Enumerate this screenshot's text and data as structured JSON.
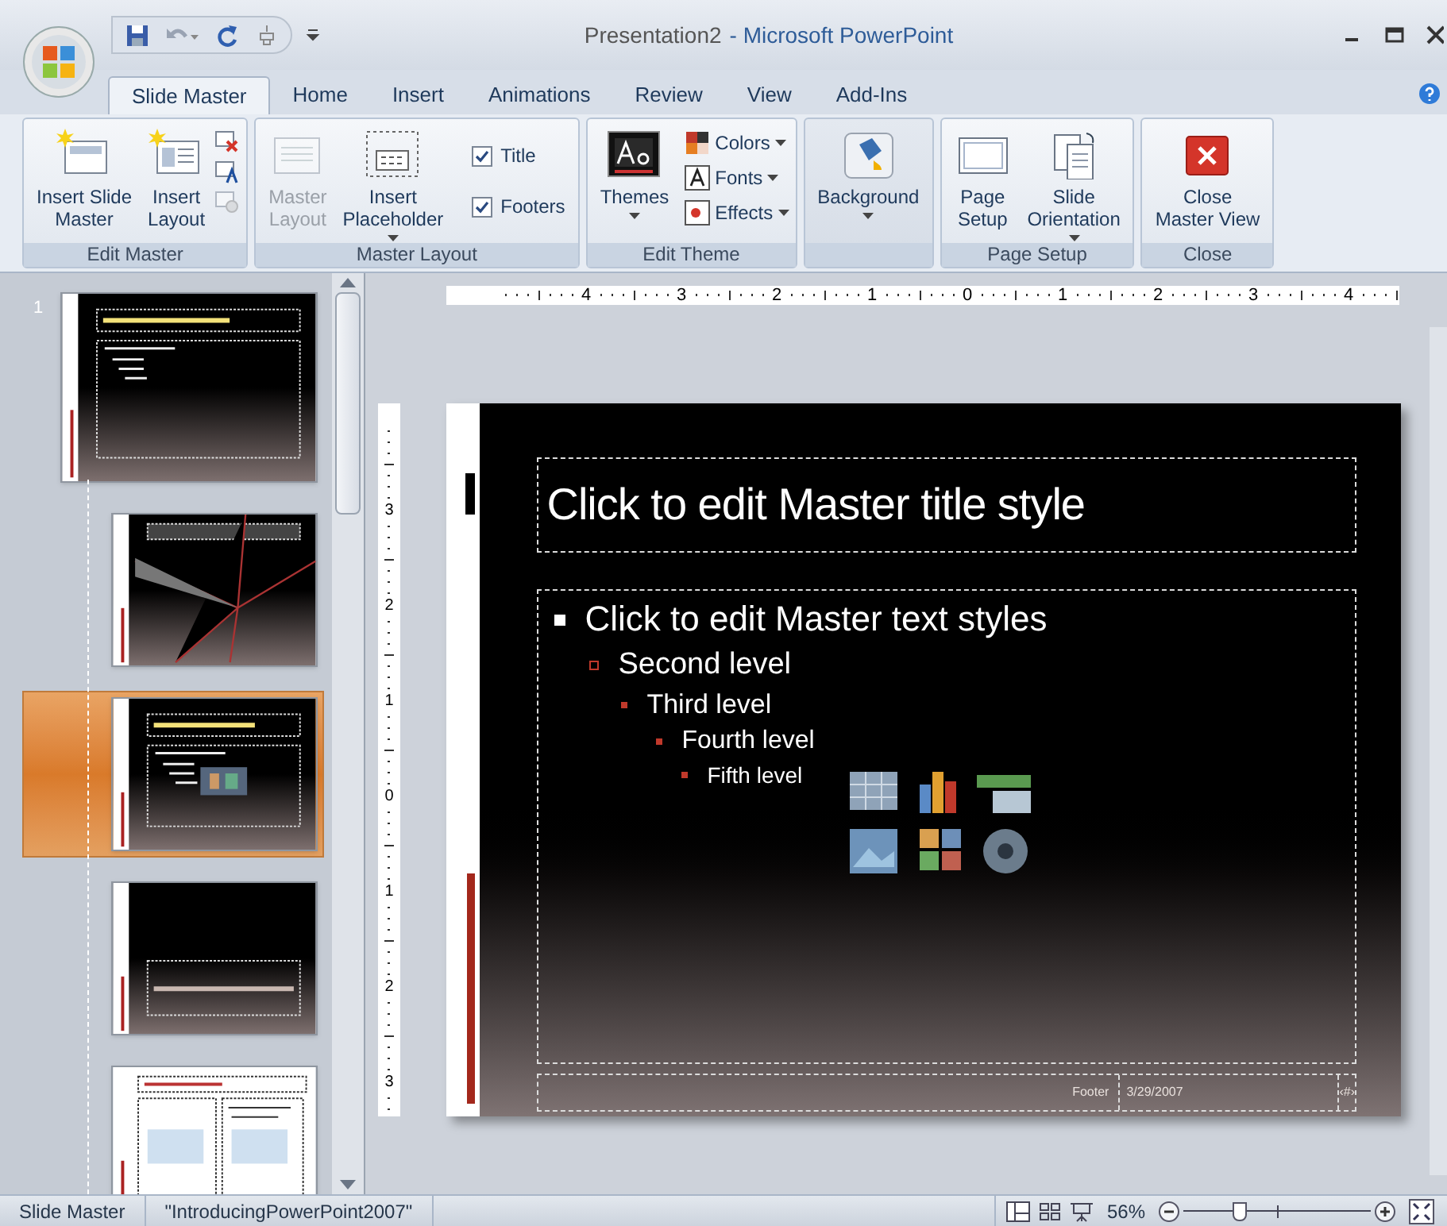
{
  "window": {
    "document": "Presentation2",
    "app": "- Microsoft PowerPoint"
  },
  "tabs": [
    {
      "label": "Slide Master",
      "selected": true
    },
    {
      "label": "Home",
      "selected": false
    },
    {
      "label": "Insert",
      "selected": false
    },
    {
      "label": "Animations",
      "selected": false
    },
    {
      "label": "Review",
      "selected": false
    },
    {
      "label": "View",
      "selected": false
    },
    {
      "label": "Add-Ins",
      "selected": false
    }
  ],
  "ribbon": [
    {
      "label": "Edit Master",
      "items": [
        {
          "kind": "large",
          "label": "Insert Slide\nMaster",
          "disabled": false,
          "dropdown": false
        },
        {
          "kind": "large",
          "label": "Insert\nLayout",
          "disabled": false,
          "dropdown": false
        },
        {
          "kind": "icon-column"
        }
      ]
    },
    {
      "label": "Master Layout",
      "items": [
        {
          "kind": "large",
          "label": "Master\nLayout",
          "disabled": true,
          "dropdown": false
        },
        {
          "kind": "large",
          "label": "Insert\nPlaceholder",
          "disabled": false,
          "dropdown": true
        },
        {
          "kind": "checks",
          "checks": [
            {
              "label": "Title",
              "checked": true
            },
            {
              "label": "Footers",
              "checked": true
            }
          ]
        }
      ]
    },
    {
      "label": "Edit Theme",
      "items": [
        {
          "kind": "large",
          "label": "Themes",
          "disabled": false,
          "dropdown": true
        },
        {
          "kind": "small-list",
          "entries": [
            {
              "label": "Colors",
              "dropdown": true
            },
            {
              "label": "Fonts",
              "dropdown": true
            },
            {
              "label": "Effects",
              "dropdown": true
            }
          ]
        }
      ]
    },
    {
      "items": [
        {
          "kind": "large",
          "label": "Background",
          "disabled": false,
          "dropdown": true
        }
      ]
    },
    {
      "label": "Page Setup",
      "items": [
        {
          "kind": "large",
          "label": "Page\nSetup",
          "disabled": false,
          "dropdown": false
        },
        {
          "kind": "large",
          "label": "Slide\nOrientation",
          "disabled": false,
          "dropdown": true
        }
      ]
    },
    {
      "label": "Close",
      "items": [
        {
          "kind": "large",
          "label": "Close\nMaster View",
          "disabled": false,
          "dropdown": false
        }
      ]
    }
  ],
  "thumbnails": [
    {
      "number": "1",
      "kind": "dark",
      "selected": false
    },
    {
      "kind": "rays",
      "selected": false
    },
    {
      "kind": "content",
      "selected": true
    },
    {
      "kind": "section",
      "selected": false
    },
    {
      "kind": "two-content",
      "selected": false
    }
  ],
  "ruler": {
    "horizontal": [
      "4",
      "3",
      "2",
      "1",
      "0",
      "1",
      "2",
      "3",
      "4"
    ],
    "vertical": [
      "3",
      "2",
      "1",
      "0",
      "1",
      "2",
      "3"
    ]
  },
  "slide": {
    "title": "Click to edit Master title style",
    "body": [
      {
        "text": "Click to edit Master text styles",
        "children": [
          {
            "text": "Second level",
            "children": [
              {
                "text": "Third level",
                "children": [
                  {
                    "text": "Fourth level",
                    "children": [
                      {
                        "text": "Fifth level"
                      }
                    ]
                  }
                ]
              }
            ]
          }
        ]
      }
    ],
    "footer": "Footer",
    "date": "3/29/2007",
    "number": "‹#›"
  },
  "status_bar": {
    "mode": "Slide Master",
    "theme": "\"IntroducingPowerPoint2007\"",
    "zoom": "56%",
    "zoom_slider": {
      "level": 0.3
    }
  }
}
